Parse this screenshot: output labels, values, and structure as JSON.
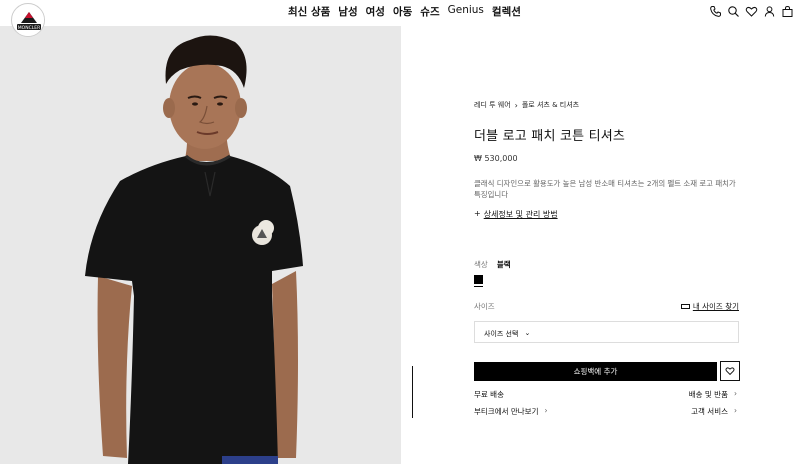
{
  "header": {
    "logo_text": "MONCLER",
    "nav": [
      "최신 상품",
      "남성",
      "여성",
      "아동",
      "슈즈",
      "Genius",
      "컬렉션"
    ]
  },
  "breadcrumb": [
    "레디 투 웨어",
    "폴로 셔츠 & 티셔츠"
  ],
  "product": {
    "title": "더블 로고 패치 코튼 티셔츠",
    "price": "₩ 530,000",
    "description": "클래식 디자인으로 활용도가 높은 남성 반소매 티셔츠는 2개의 펠트 소재 로고 패치가 특징입니다",
    "details_prefix": "+",
    "details_link": "상세정보 및 관리 방법"
  },
  "color": {
    "label": "색상",
    "value": "블랙",
    "swatch": "#000000"
  },
  "size": {
    "label": "사이즈",
    "guide": "내 사이즈 찾기",
    "select_placeholder": "사이즈 선택"
  },
  "actions": {
    "add_to_bag": "쇼핑백에 추가"
  },
  "links": {
    "free_shipping": "무료 배송",
    "shipping_returns": "배송 및 반품",
    "boutique": "부티크에서 만나보기",
    "customer_service": "고객 서비스"
  }
}
